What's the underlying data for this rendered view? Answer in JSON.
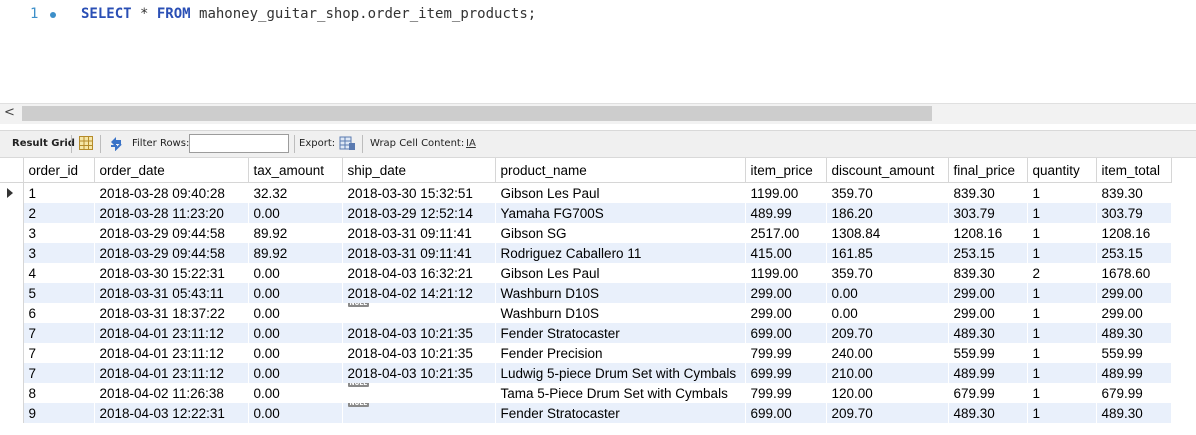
{
  "editor": {
    "line_number": "1",
    "kw_select": "SELECT",
    "star": " * ",
    "kw_from": "FROM",
    "table_ref": " mahoney_guitar_shop.order_item_products;"
  },
  "scrollbar": {
    "left_arrow": "<"
  },
  "toolbar": {
    "result_grid": "Result Grid",
    "filter_rows": "Filter Rows:",
    "filter_value": "",
    "export": "Export:",
    "wrap_cell": "Wrap Cell Content:",
    "wrap_icon": "IA"
  },
  "columns": [
    "order_id",
    "order_date",
    "tax_amount",
    "ship_date",
    "product_name",
    "item_price",
    "discount_amount",
    "final_price",
    "quantity",
    "item_total"
  ],
  "null_label": "NULL",
  "rows": [
    [
      "1",
      "2018-03-28 09:40:28",
      "32.32",
      "2018-03-30 15:32:51",
      "Gibson Les Paul",
      "1199.00",
      "359.70",
      "839.30",
      "1",
      "839.30"
    ],
    [
      "2",
      "2018-03-28 11:23:20",
      "0.00",
      "2018-03-29 12:52:14",
      "Yamaha FG700S",
      "489.99",
      "186.20",
      "303.79",
      "1",
      "303.79"
    ],
    [
      "3",
      "2018-03-29 09:44:58",
      "89.92",
      "2018-03-31 09:11:41",
      "Gibson SG",
      "2517.00",
      "1308.84",
      "1208.16",
      "1",
      "1208.16"
    ],
    [
      "3",
      "2018-03-29 09:44:58",
      "89.92",
      "2018-03-31 09:11:41",
      "Rodriguez Caballero 11",
      "415.00",
      "161.85",
      "253.15",
      "1",
      "253.15"
    ],
    [
      "4",
      "2018-03-30 15:22:31",
      "0.00",
      "2018-04-03 16:32:21",
      "Gibson Les Paul",
      "1199.00",
      "359.70",
      "839.30",
      "2",
      "1678.60"
    ],
    [
      "5",
      "2018-03-31 05:43:11",
      "0.00",
      "2018-04-02 14:21:12",
      "Washburn D10S",
      "299.00",
      "0.00",
      "299.00",
      "1",
      "299.00"
    ],
    [
      "6",
      "2018-03-31 18:37:22",
      "0.00",
      null,
      "Washburn D10S",
      "299.00",
      "0.00",
      "299.00",
      "1",
      "299.00"
    ],
    [
      "7",
      "2018-04-01 23:11:12",
      "0.00",
      "2018-04-03 10:21:35",
      "Fender Stratocaster",
      "699.00",
      "209.70",
      "489.30",
      "1",
      "489.30"
    ],
    [
      "7",
      "2018-04-01 23:11:12",
      "0.00",
      "2018-04-03 10:21:35",
      "Fender Precision",
      "799.99",
      "240.00",
      "559.99",
      "1",
      "559.99"
    ],
    [
      "7",
      "2018-04-01 23:11:12",
      "0.00",
      "2018-04-03 10:21:35",
      "Ludwig 5-piece Drum Set with Cymbals",
      "699.99",
      "210.00",
      "489.99",
      "1",
      "489.99"
    ],
    [
      "8",
      "2018-04-02 11:26:38",
      "0.00",
      null,
      "Tama 5-Piece Drum Set with Cymbals",
      "799.99",
      "120.00",
      "679.99",
      "1",
      "679.99"
    ],
    [
      "9",
      "2018-04-03 12:22:31",
      "0.00",
      null,
      "Fender Stratocaster",
      "699.00",
      "209.70",
      "489.30",
      "1",
      "489.30"
    ]
  ]
}
